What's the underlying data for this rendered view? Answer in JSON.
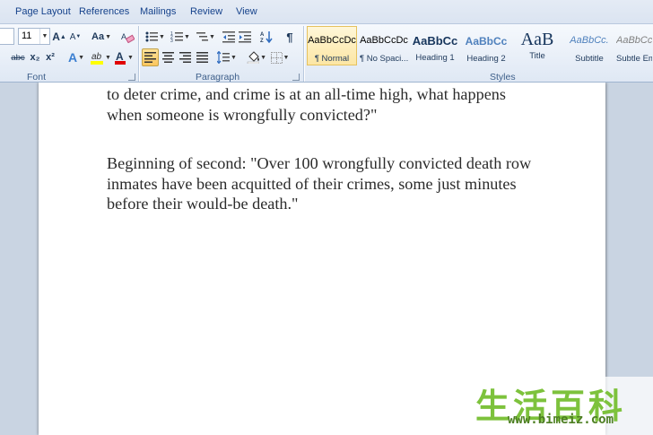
{
  "tabs": [
    "Page Layout",
    "References",
    "Mailings",
    "Review",
    "View"
  ],
  "font": {
    "size": "11",
    "grow_label": "A",
    "shrink_label": "A",
    "change_case_label": "Aa",
    "strike_label": "abc",
    "subscript_label": "x₂",
    "superscript_label": "x²",
    "effects_label": "A",
    "font_color_label": "A",
    "group_label": "Font"
  },
  "paragraph": {
    "show_hide_label": "¶",
    "group_label": "Paragraph"
  },
  "styles": {
    "group_label": "Styles",
    "items": [
      {
        "sample": "AaBbCcDc",
        "name": "¶ Normal"
      },
      {
        "sample": "AaBbCcDc",
        "name": "¶ No Spaci..."
      },
      {
        "sample": "AaBbCc",
        "name": "Heading 1"
      },
      {
        "sample": "AaBbCc",
        "name": "Heading 2"
      },
      {
        "sample": "AaB",
        "name": "Title"
      },
      {
        "sample": "AaBbCc.",
        "name": "Subtitle"
      },
      {
        "sample": "AaBbCcl",
        "name": "Subtle Em"
      }
    ]
  },
  "document": {
    "paragraph1": "to deter crime, and crime is at an all-time high, what happens when someone is wrongfully convicted?\"",
    "paragraph2": "Beginning of second: \"Over 100 wrongfully convicted death row inmates have been acquitted of their crimes, some just minutes before their would-be death.\""
  },
  "watermark": {
    "text": "生活百科",
    "url": "www.bimeiz.com"
  },
  "colors": {
    "accent": "#15428b",
    "ribbon_bg": "#dfe8f4",
    "selected_style": "#fce6a4",
    "highlight": "#ffff00",
    "font_color": "#e00000",
    "watermark_green": "#7dc23c"
  }
}
